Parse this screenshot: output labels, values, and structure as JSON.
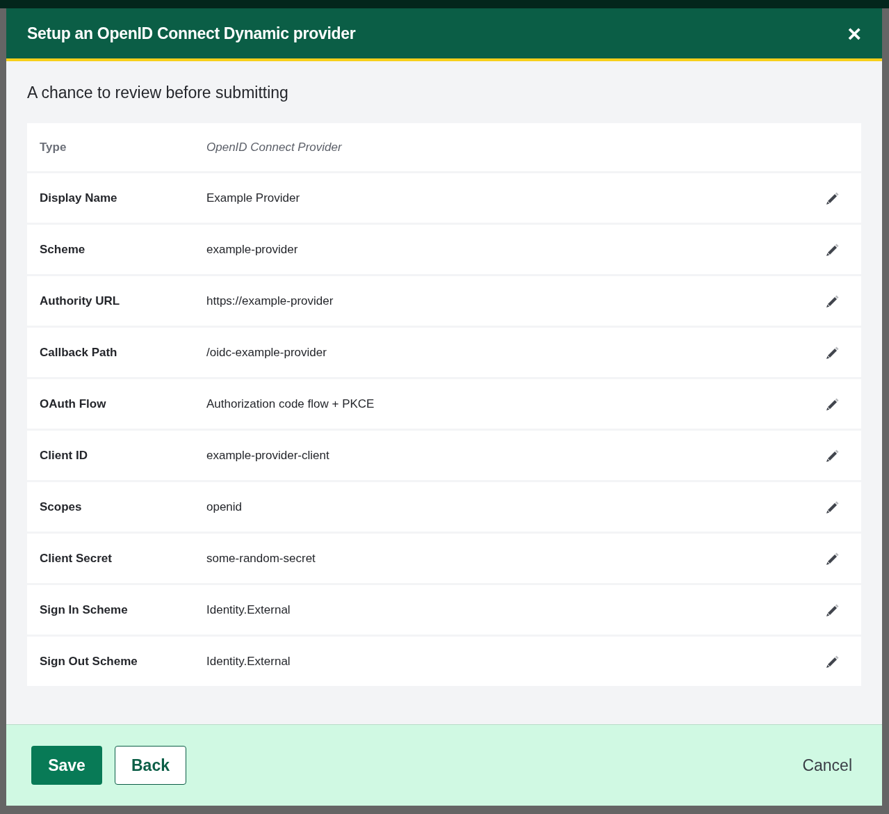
{
  "dialog": {
    "title": "Setup an OpenID Connect Dynamic provider",
    "close": "×"
  },
  "subtitle": "A chance to review before submitting",
  "rows": [
    {
      "kind": "static",
      "label": "Type",
      "value": "OpenID Connect Provider"
    },
    {
      "kind": "editable",
      "label": "Display Name",
      "value": "Example Provider"
    },
    {
      "kind": "editable",
      "label": "Scheme",
      "value": "example-provider"
    },
    {
      "kind": "editable",
      "label": "Authority URL",
      "value": "https://example-provider"
    },
    {
      "kind": "editable",
      "label": "Callback Path",
      "value": "/oidc-example-provider"
    },
    {
      "kind": "editable",
      "label": "OAuth Flow",
      "value": "Authorization code flow + PKCE"
    },
    {
      "kind": "editable",
      "label": "Client ID",
      "value": "example-provider-client"
    },
    {
      "kind": "editable",
      "label": "Scopes",
      "value": "openid"
    },
    {
      "kind": "editable",
      "label": "Client Secret",
      "value": "some-random-secret"
    },
    {
      "kind": "editable",
      "label": "Sign In Scheme",
      "value": "Identity.External"
    },
    {
      "kind": "editable",
      "label": "Sign Out Scheme",
      "value": "Identity.External"
    }
  ],
  "footer": {
    "save": "Save",
    "back": "Back",
    "cancel": "Cancel"
  }
}
